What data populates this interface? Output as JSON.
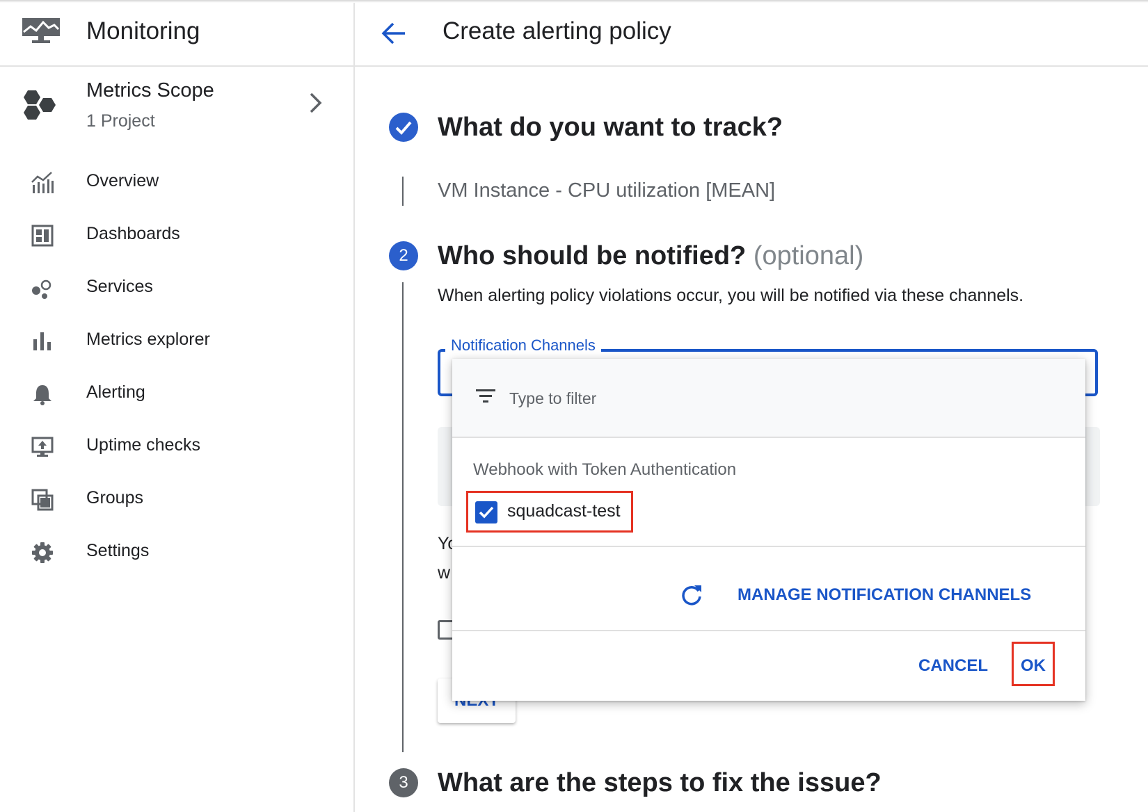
{
  "app": {
    "title": "Monitoring"
  },
  "scope": {
    "title": "Metrics Scope",
    "subtitle": "1 Project"
  },
  "nav": [
    {
      "label": "Overview",
      "icon": "overview-chart-icon"
    },
    {
      "label": "Dashboards",
      "icon": "dashboard-icon"
    },
    {
      "label": "Services",
      "icon": "services-icon"
    },
    {
      "label": "Metrics explorer",
      "icon": "bar-chart-icon"
    },
    {
      "label": "Alerting",
      "icon": "bell-icon"
    },
    {
      "label": "Uptime checks",
      "icon": "monitor-upload-icon"
    },
    {
      "label": "Groups",
      "icon": "groups-icon"
    },
    {
      "label": "Settings",
      "icon": "gear-icon"
    }
  ],
  "page": {
    "title": "Create alerting policy"
  },
  "steps": [
    {
      "number": "",
      "title": "What do you want to track?",
      "status": "complete",
      "summary": "VM Instance - CPU utilization [MEAN]"
    },
    {
      "number": "2",
      "title": "Who should be notified?",
      "optional": "(optional)",
      "status": "active",
      "description": "When alerting policy violations occur, you will be notified via these channels."
    },
    {
      "number": "3",
      "title": "What are the steps to fix the issue?",
      "status": "pending"
    }
  ],
  "field": {
    "label": "Notification Channels",
    "behind_text_1": "Yo",
    "behind_text_2": "w",
    "next_label": "NEXT"
  },
  "dropdown": {
    "filter_placeholder": "Type to filter",
    "group": "Webhook with Token Authentication",
    "option": {
      "label": "squadcast-test",
      "checked": true
    },
    "manage_label": "MANAGE NOTIFICATION CHANNELS",
    "cancel_label": "CANCEL",
    "ok_label": "OK"
  },
  "colors": {
    "accent": "#1a56c8",
    "step_blue": "#2b5fcc",
    "step_pending": "#5f6368",
    "highlight": "#e53222",
    "icon_gray": "#5f6368"
  }
}
